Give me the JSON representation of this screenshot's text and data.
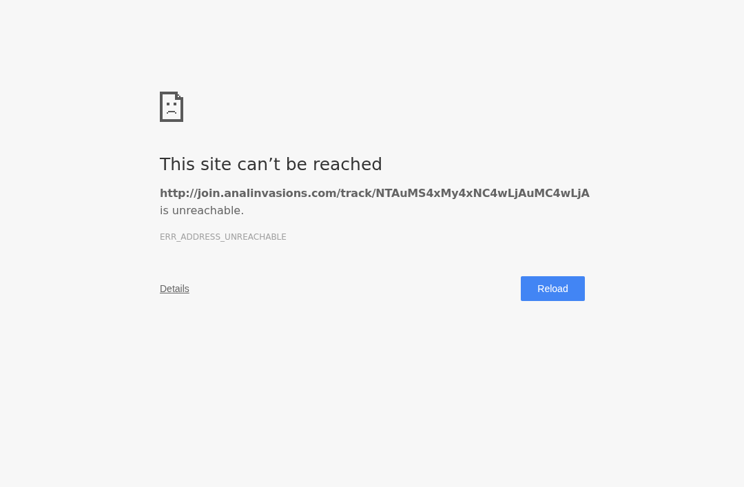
{
  "heading": "This site can’t be reached",
  "url": "http://join.analinvasions.com/track/NTAuMS4xMy4xNC4wLjAuMC4wLjA",
  "message": "is unreachable.",
  "error_code": "ERR_ADDRESS_UNREACHABLE",
  "details_link": "Details",
  "reload_button": "Reload"
}
